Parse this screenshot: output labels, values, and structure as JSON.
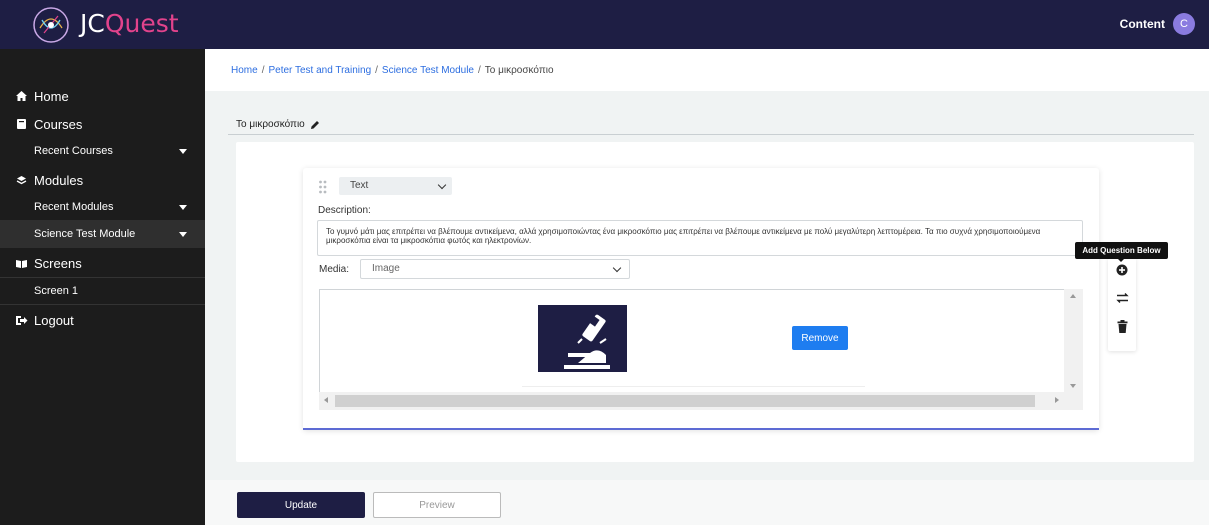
{
  "app": {
    "name_part1": "JC",
    "name_part2": "Quest",
    "brand_color": "#1e1e44",
    "accent_color": "#e2438c"
  },
  "header": {
    "user_label": "Content",
    "avatar_initial": "C"
  },
  "sidebar": {
    "items": [
      {
        "label": "Home",
        "icon": "home-icon"
      },
      {
        "label": "Courses",
        "icon": "book-icon"
      },
      {
        "label": "Recent Courses",
        "icon": "caret-down-icon"
      },
      {
        "label": "Modules",
        "icon": "layers-icon"
      },
      {
        "label": "Recent Modules",
        "icon": "caret-down-icon"
      },
      {
        "label": "Science Test Module",
        "icon": "caret-down-icon"
      },
      {
        "label": "Screens",
        "icon": "open-book-icon"
      },
      {
        "label": "Screen 1",
        "icon": ""
      },
      {
        "label": "Logout",
        "icon": "logout-icon"
      }
    ]
  },
  "breadcrumb": {
    "items": [
      "Home",
      "Peter Test and Training",
      "Science Test Module"
    ],
    "current": "Το μικροσκόπιο",
    "separator": "/"
  },
  "page": {
    "title": "Το μικροσκόπιο"
  },
  "question": {
    "type": "Text",
    "description_label": "Description:",
    "description": "Το γυμνό μάτι μας επιτρέπει να βλέπουμε αντικείμενα, αλλά χρησιμοποιώντας ένα μικροσκόπιο μας επιτρέπει να βλέπουμε αντικείμενα με πολύ μεγαλύτερη λεπτομέρεια. Τα πιο συχνά χρησιμοποιούμενα μικροσκόπια είναι τα μικροσκόπια φωτός και ηλεκτρονίων.",
    "media_label": "Media:",
    "media_type": "Image",
    "remove_label": "Remove"
  },
  "tools": {
    "tooltip": "Add Question Below"
  },
  "footer": {
    "update_label": "Update",
    "preview_label": "Preview"
  }
}
